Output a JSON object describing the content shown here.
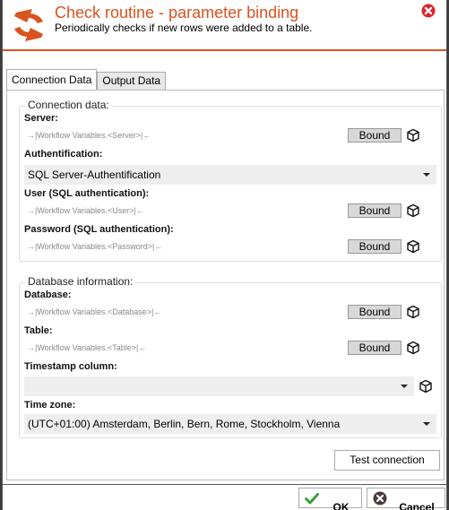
{
  "header": {
    "title": "Check routine - parameter binding",
    "subtitle": "Periodically checks if new rows were added to a table.",
    "accent_color": "#d9531e"
  },
  "tabs": [
    {
      "label": "Connection Data",
      "active": true
    },
    {
      "label": "Output Data",
      "active": false
    }
  ],
  "connection_group": {
    "legend": "Connection data:",
    "server": {
      "label": "Server:",
      "binding": "→|Workflow Variables.<Server>|←",
      "bound_label": "Bound"
    },
    "authentication": {
      "label": "Authentification:",
      "value": "SQL Server-Authentification"
    },
    "user": {
      "label": "User (SQL authentication):",
      "binding": "→|Workflow Variables.<User>|←",
      "bound_label": "Bound"
    },
    "password": {
      "label": "Password (SQL authentication):",
      "binding": "→|Workflow Variables.<Password>|←",
      "bound_label": "Bound"
    }
  },
  "database_group": {
    "legend": "Database information:",
    "database": {
      "label": "Database:",
      "binding": "→|Workflow Variables.<Database>|←",
      "bound_label": "Bound"
    },
    "table": {
      "label": "Table:",
      "binding": "→|Workflow Variables.<Table>|←",
      "bound_label": "Bound"
    },
    "timestamp": {
      "label": "Timestamp column:",
      "value": ""
    },
    "timezone": {
      "label": "Time zone:",
      "value": "(UTC+01:00) Amsterdam, Berlin, Bern, Rome, Stockholm, Vienna"
    }
  },
  "buttons": {
    "test_connection": "Test connection",
    "ok": "OK",
    "cancel": "Cancel"
  },
  "icons": {
    "logo": "refresh-arrows-icon",
    "close": "close-circle-icon",
    "bind": "cube-icon",
    "ok": "checkmark-icon",
    "cancel": "cancel-circle-icon"
  }
}
